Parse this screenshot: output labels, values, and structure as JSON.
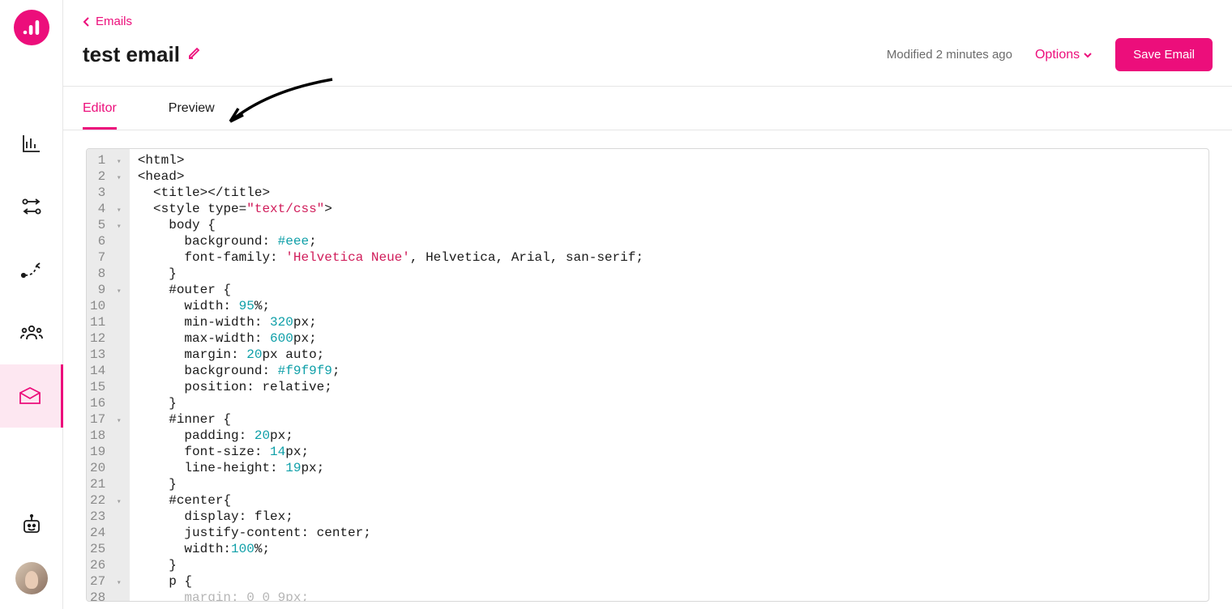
{
  "breadcrumb": {
    "back_label": "Emails"
  },
  "header": {
    "title": "test email",
    "modified_text": "Modified 2 minutes ago",
    "options_label": "Options",
    "save_label": "Save Email"
  },
  "tabs": {
    "editor": "Editor",
    "preview": "Preview"
  },
  "code": {
    "lines": [
      {
        "n": 1,
        "fold": true,
        "html": "<span class='tok-tag'>&lt;html&gt;</span>"
      },
      {
        "n": 2,
        "fold": true,
        "html": "<span class='tok-tag'>&lt;head&gt;</span>"
      },
      {
        "n": 3,
        "fold": false,
        "html": "  <span class='tok-tag'>&lt;title&gt;&lt;/title&gt;</span>"
      },
      {
        "n": 4,
        "fold": true,
        "html": "  <span class='tok-tag'>&lt;style</span> <span class='tok-attr'>type=</span><span class='tok-str'>\"text/css\"</span><span class='tok-tag'>&gt;</span>"
      },
      {
        "n": 5,
        "fold": true,
        "html": "    <span class='tok-sel'>body</span> {"
      },
      {
        "n": 6,
        "fold": false,
        "html": "      <span class='tok-prop'>background:</span> <span class='tok-hex'>#eee</span>;"
      },
      {
        "n": 7,
        "fold": false,
        "html": "      <span class='tok-prop'>font-family:</span> <span class='tok-str2'>'Helvetica Neue'</span>, Helvetica, Arial, san-serif;"
      },
      {
        "n": 8,
        "fold": false,
        "html": "    }"
      },
      {
        "n": 9,
        "fold": true,
        "html": "    <span class='tok-sel'>#outer</span> {"
      },
      {
        "n": 10,
        "fold": false,
        "html": "      <span class='tok-prop'>width:</span> <span class='tok-num'>95</span>%;"
      },
      {
        "n": 11,
        "fold": false,
        "html": "      <span class='tok-prop'>min-width:</span> <span class='tok-num'>320</span>px;"
      },
      {
        "n": 12,
        "fold": false,
        "html": "      <span class='tok-prop'>max-width:</span> <span class='tok-num'>600</span>px;"
      },
      {
        "n": 13,
        "fold": false,
        "html": "      <span class='tok-prop'>margin:</span> <span class='tok-num'>20</span>px auto;"
      },
      {
        "n": 14,
        "fold": false,
        "html": "      <span class='tok-prop'>background:</span> <span class='tok-hex'>#f9f9f9</span>;"
      },
      {
        "n": 15,
        "fold": false,
        "html": "      <span class='tok-prop'>position:</span> relative;"
      },
      {
        "n": 16,
        "fold": false,
        "html": "    }"
      },
      {
        "n": 17,
        "fold": true,
        "html": "    <span class='tok-sel'>#inner</span> {"
      },
      {
        "n": 18,
        "fold": false,
        "html": "      <span class='tok-prop'>padding:</span> <span class='tok-num'>20</span>px;"
      },
      {
        "n": 19,
        "fold": false,
        "html": "      <span class='tok-prop'>font-size:</span> <span class='tok-num'>14</span>px;"
      },
      {
        "n": 20,
        "fold": false,
        "html": "      <span class='tok-prop'>line-height:</span> <span class='tok-num'>19</span>px;"
      },
      {
        "n": 21,
        "fold": false,
        "html": "    }"
      },
      {
        "n": 22,
        "fold": true,
        "html": "    <span class='tok-sel'>#center</span>{"
      },
      {
        "n": 23,
        "fold": false,
        "html": "      <span class='tok-prop'>display:</span> flex;"
      },
      {
        "n": 24,
        "fold": false,
        "html": "      <span class='tok-prop'>justify-content:</span> center;"
      },
      {
        "n": 25,
        "fold": false,
        "html": "      <span class='tok-prop'>width:</span><span class='tok-num'>100</span>%;"
      },
      {
        "n": 26,
        "fold": false,
        "html": "    }"
      },
      {
        "n": 27,
        "fold": true,
        "html": "    <span class='tok-sel'>p</span> {"
      },
      {
        "n": 28,
        "fold": false,
        "html": "<span class='faded'>      margin: </span><span class='tok-num faded'>0 0 9</span><span class='faded'>px;</span>"
      }
    ]
  }
}
